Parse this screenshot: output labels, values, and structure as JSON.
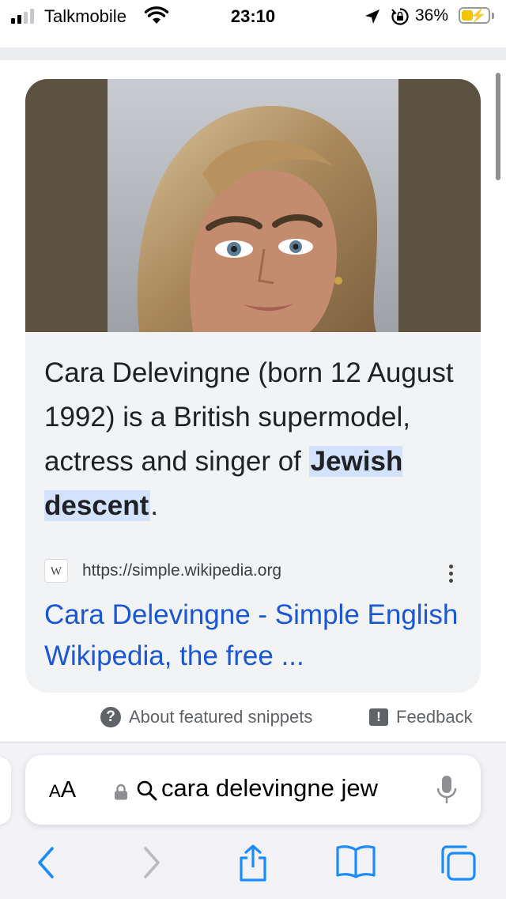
{
  "status_bar": {
    "carrier": "Talkmobile",
    "time": "23:10",
    "battery_percent": "36%",
    "battery_level": 0.36,
    "charging": true
  },
  "featured_snippet": {
    "text_before": "Cara Delevingne (born 12 August 1992) is a British supermodel, actress and singer of ",
    "highlight": "Jewish descent",
    "text_after": ".",
    "source_logo": "W",
    "source_url": "https://simple.wikipedia.org",
    "link_title": "Cara Delevingne - Simple English Wikipedia, the free ...",
    "hero_image": "portrait-photo",
    "hero_bg": "#5d5240"
  },
  "meta": {
    "about": "About featured snippets",
    "feedback": "Feedback"
  },
  "browser": {
    "aa_label_small": "A",
    "aa_label_large": "A",
    "query": "cara delevingne jew",
    "accent": "#1a8cff"
  },
  "icons": [
    "signal-icon",
    "wifi-icon",
    "location-icon",
    "orientation-lock-icon",
    "battery-icon",
    "help-icon",
    "feedback-icon",
    "padlock-icon",
    "search-icon",
    "microphone-icon",
    "back-icon",
    "forward-icon",
    "share-icon",
    "bookmarks-icon",
    "tabs-icon",
    "more-options-icon"
  ]
}
